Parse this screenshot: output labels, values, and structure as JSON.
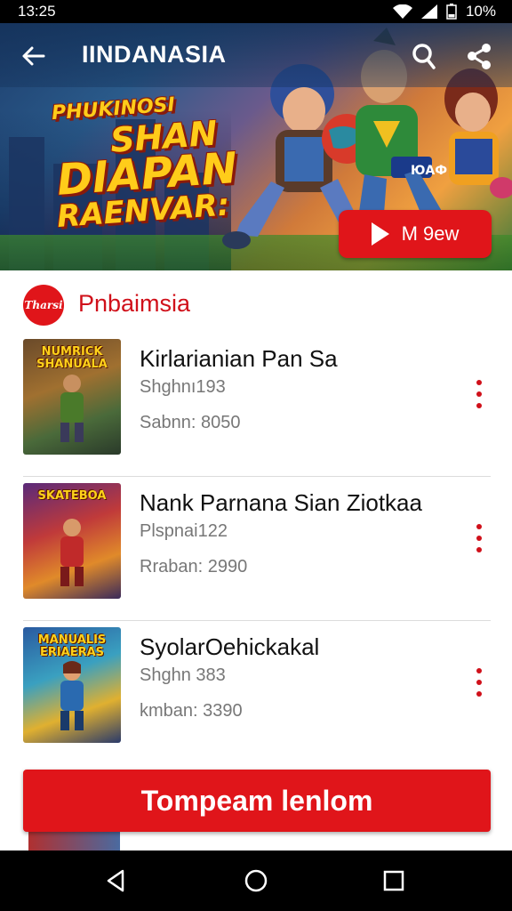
{
  "status_bar": {
    "time": "13:25",
    "battery": "10%"
  },
  "app_bar": {
    "title": "IINDANASIA"
  },
  "hero": {
    "promo_lines": [
      "PHUKINOSI",
      "SHAN",
      "DIAPAN",
      "RAENVAR:"
    ],
    "badge_text": "ЮАФ",
    "watch_button_label": "M 9ew"
  },
  "section": {
    "logo_text": "Tharsi",
    "title": "Pnbaimsia"
  },
  "items": [
    {
      "title": "Kirlarianian Pan Sa",
      "subtitle": "Shghnı193",
      "meta": "Sabnn: 8050",
      "thumb_label": "NUMRICK SHANUALA"
    },
    {
      "title": "Nank Parnana Sian Ziotkaa",
      "subtitle": "Plspnai122",
      "meta": "Rraban: 2990",
      "thumb_label": "SKATEBOA"
    },
    {
      "title": "SyolarOehickakal",
      "subtitle": "Shghn 383",
      "meta": "kmban: 3390",
      "thumb_label": "MANUALIS ERIAERAS"
    }
  ],
  "action_button_label": "Tompeam lenlom",
  "colors": {
    "accent": "#e0151a",
    "accent_text": "#d0101a",
    "meta_text": "#777777"
  }
}
